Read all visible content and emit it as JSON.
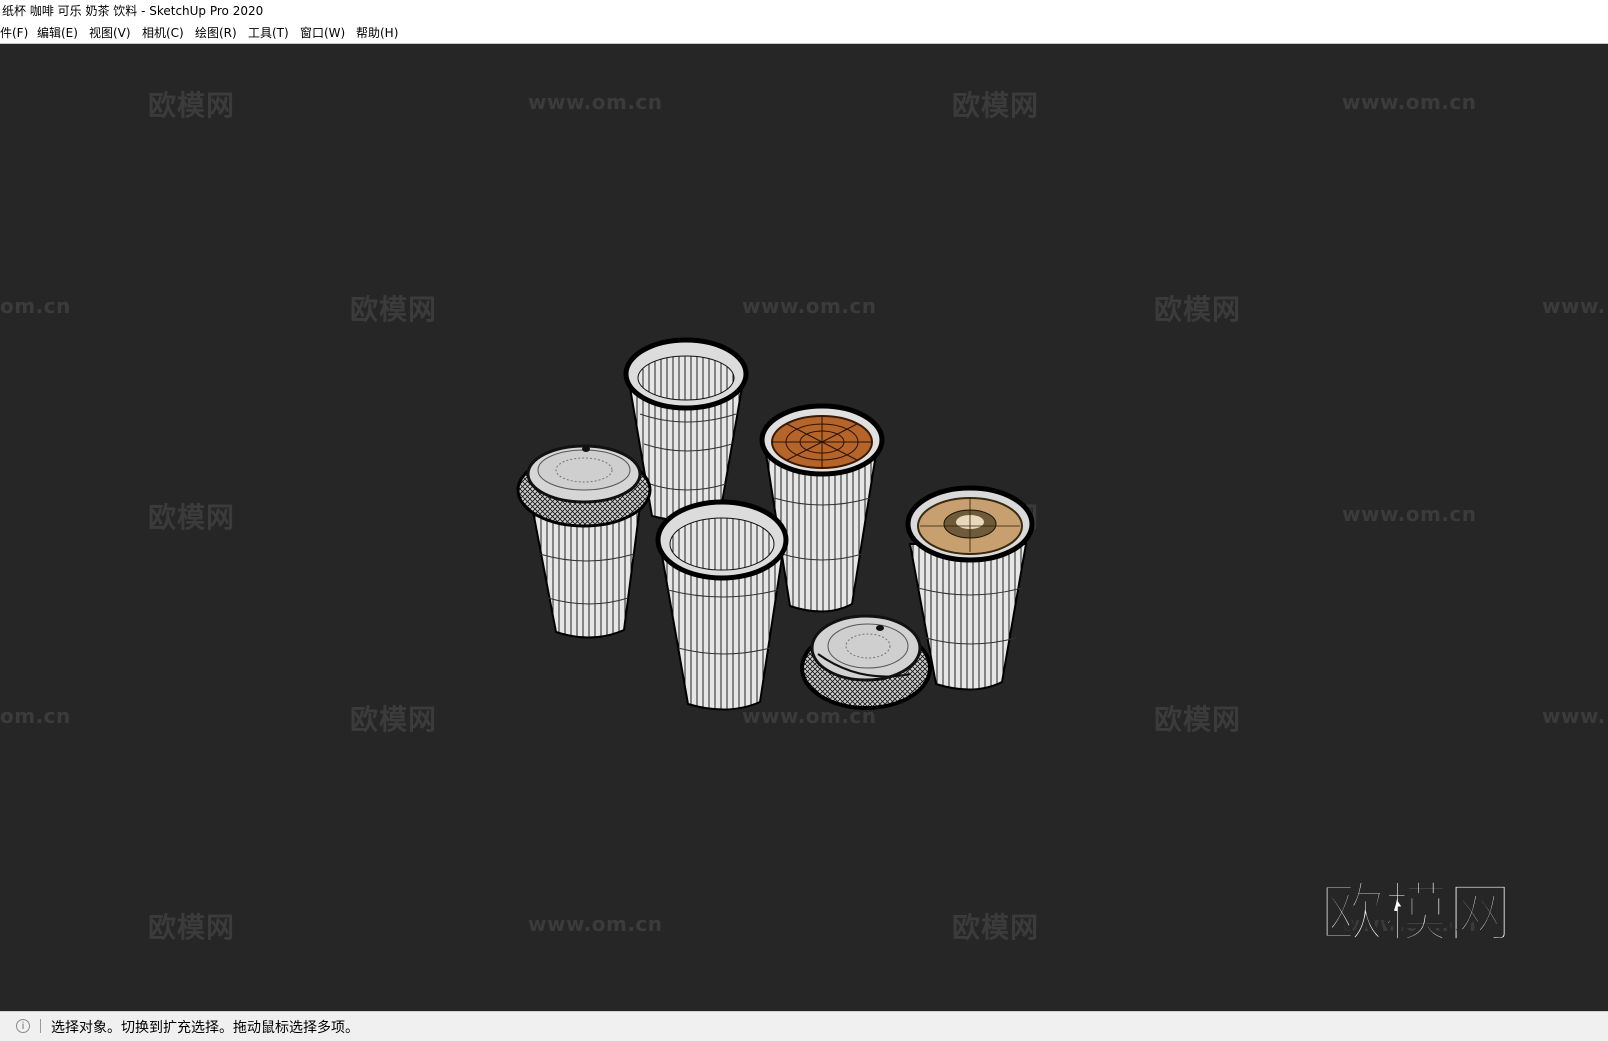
{
  "window": {
    "title": "纸杯 咖啡 可乐 奶茶 饮料 - SketchUp Pro 2020"
  },
  "menu": [
    {
      "label": "件(F)"
    },
    {
      "label": "编辑(E)"
    },
    {
      "label": "视图(V)"
    },
    {
      "label": "相机(C)"
    },
    {
      "label": "绘图(R)"
    },
    {
      "label": "工具(T)"
    },
    {
      "label": "窗口(W)"
    },
    {
      "label": "帮助(H)"
    }
  ],
  "watermarks": {
    "brand": "欧模网",
    "url": "www.om.cn",
    "url_clipped_left": "om.cn",
    "url_clipped_right": "www."
  },
  "logo": "欧模网",
  "status": {
    "icon": "info-icon",
    "text": "选择对象。切换到扩充选择。拖动鼠标选择多项。"
  },
  "colors": {
    "viewport_bg": "#262626",
    "cup_body": "#e8e8e8",
    "coffee": "#b5642a",
    "latte": "#c8a070",
    "lid": "#d0d0d0"
  },
  "scene": {
    "objects": [
      {
        "name": "tall-cup-open"
      },
      {
        "name": "cup-with-lid"
      },
      {
        "name": "front-cup-open"
      },
      {
        "name": "coffee-cup"
      },
      {
        "name": "latte-cup"
      },
      {
        "name": "loose-lid"
      }
    ]
  }
}
